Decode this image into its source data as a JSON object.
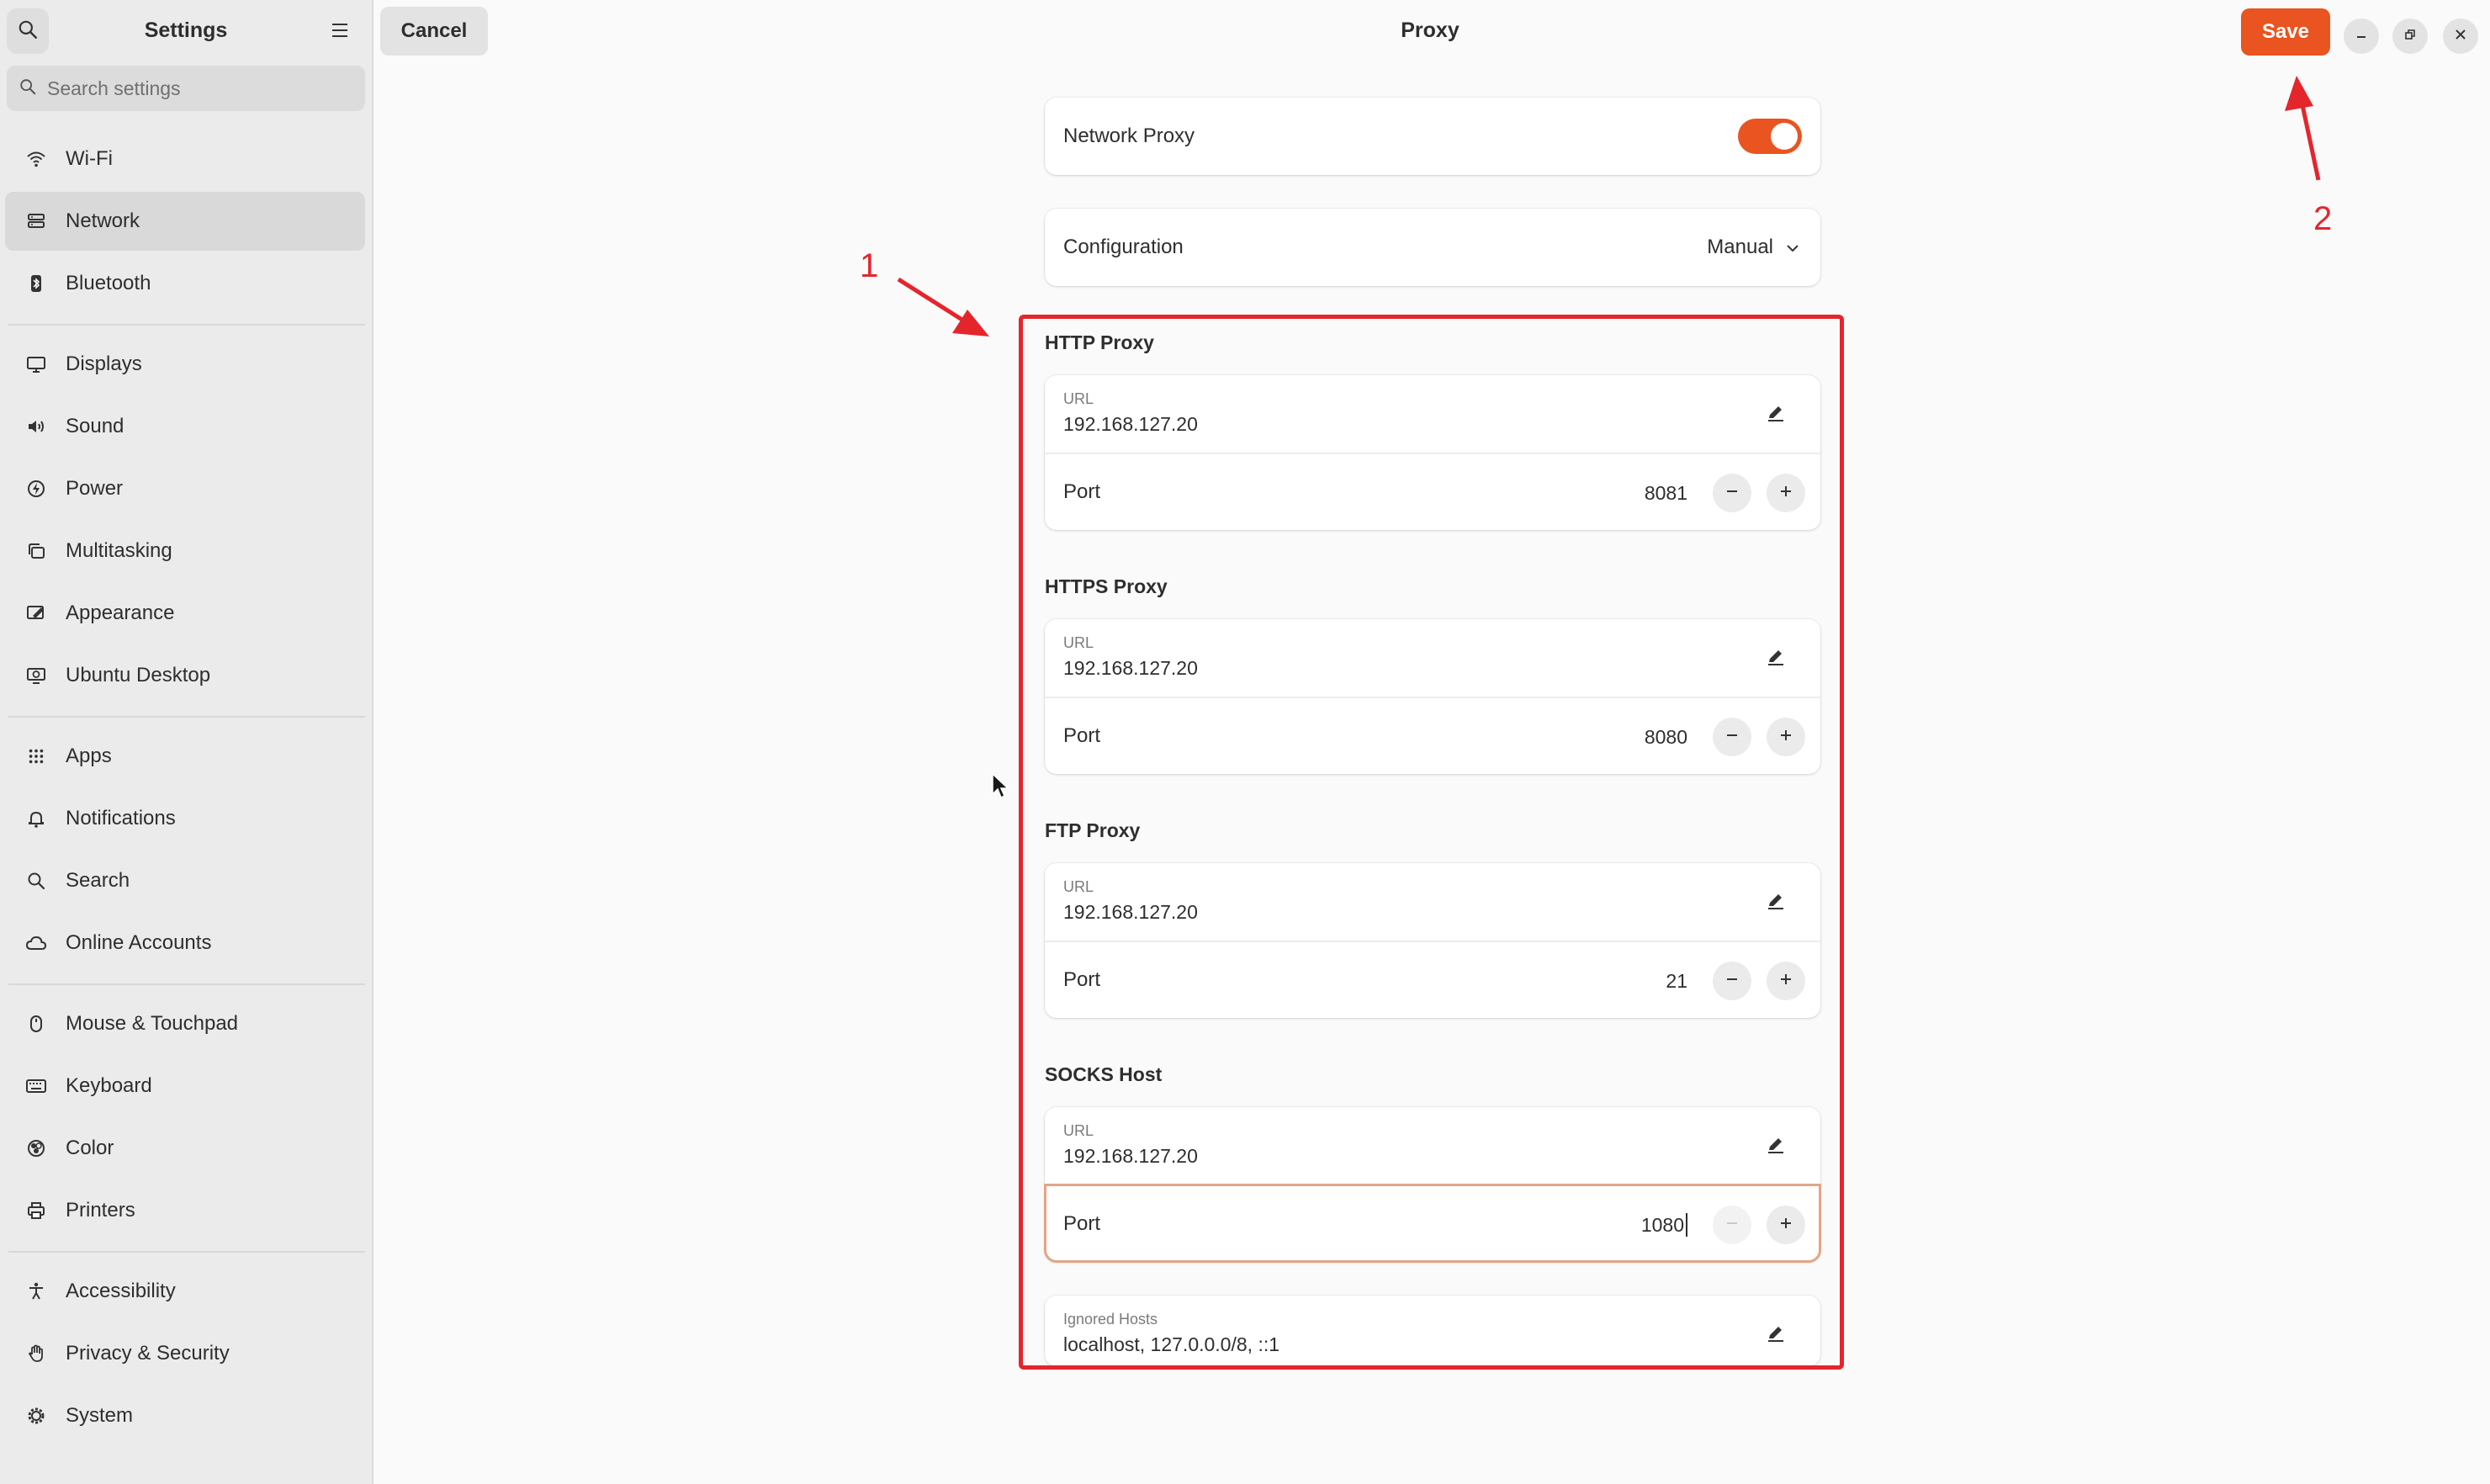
{
  "sidebar": {
    "title": "Settings",
    "search_placeholder": "Search settings",
    "items": [
      {
        "label": "Wi-Fi",
        "icon": "wifi-icon"
      },
      {
        "label": "Network",
        "icon": "network-icon",
        "active": true
      },
      {
        "label": "Bluetooth",
        "icon": "bluetooth-icon"
      },
      {
        "label": "Displays",
        "icon": "display-icon"
      },
      {
        "label": "Sound",
        "icon": "sound-icon"
      },
      {
        "label": "Power",
        "icon": "power-icon"
      },
      {
        "label": "Multitasking",
        "icon": "multitasking-icon"
      },
      {
        "label": "Appearance",
        "icon": "appearance-icon"
      },
      {
        "label": "Ubuntu Desktop",
        "icon": "ubuntu-desktop-icon"
      },
      {
        "label": "Apps",
        "icon": "apps-grid-icon"
      },
      {
        "label": "Notifications",
        "icon": "bell-icon"
      },
      {
        "label": "Search",
        "icon": "search-icon"
      },
      {
        "label": "Online Accounts",
        "icon": "cloud-icon"
      },
      {
        "label": "Mouse & Touchpad",
        "icon": "mouse-icon"
      },
      {
        "label": "Keyboard",
        "icon": "keyboard-icon"
      },
      {
        "label": "Color",
        "icon": "color-icon"
      },
      {
        "label": "Printers",
        "icon": "printer-icon"
      },
      {
        "label": "Accessibility",
        "icon": "accessibility-icon"
      },
      {
        "label": "Privacy & Security",
        "icon": "hand-icon"
      },
      {
        "label": "System",
        "icon": "gear-icon"
      }
    ]
  },
  "header": {
    "cancel_label": "Cancel",
    "title": "Proxy",
    "save_label": "Save"
  },
  "proxy": {
    "network_proxy_label": "Network Proxy",
    "network_proxy_enabled": true,
    "configuration_label": "Configuration",
    "configuration_value": "Manual",
    "url_label": "URL",
    "port_label": "Port",
    "sections": [
      {
        "title": "HTTP Proxy",
        "url": "192.168.127.20",
        "port": "8081"
      },
      {
        "title": "HTTPS Proxy",
        "url": "192.168.127.20",
        "port": "8080"
      },
      {
        "title": "FTP Proxy",
        "url": "192.168.127.20",
        "port": "21"
      },
      {
        "title": "SOCKS Host",
        "url": "192.168.127.20",
        "port": "1080"
      }
    ],
    "ignored_hosts_label": "Ignored Hosts",
    "ignored_hosts_value": "localhost, 127.0.0.0/8, ::1"
  },
  "annotations": {
    "label_1": "1",
    "label_2": "2",
    "color": "#e5252c"
  },
  "colors": {
    "accent": "#e95420",
    "sidebar_bg": "#ebebeb",
    "content_bg": "#fafafa"
  }
}
